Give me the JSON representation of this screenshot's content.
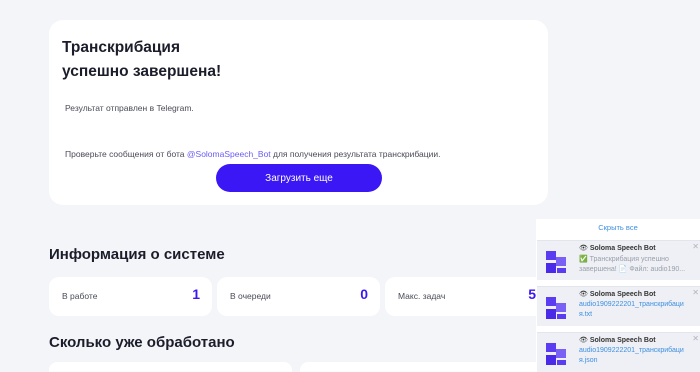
{
  "result_card": {
    "title_line1": "Транскрибация",
    "title_line2": "успешно завершена!",
    "sent_text": "Результат отправлен в Telegram.",
    "check_prefix": "Проверьте сообщения от бота ",
    "bot_link": "@SolomaSpeech_Bot",
    "check_suffix": " для получения результата транскрибации.",
    "upload_button": "Загрузить еще"
  },
  "system_info": {
    "heading": "Информация о системе",
    "stats": [
      {
        "label": "В работе",
        "value": "1"
      },
      {
        "label": "В очереди",
        "value": "0"
      },
      {
        "label": "Макс. задач",
        "value": "5"
      }
    ]
  },
  "processed": {
    "heading": "Сколько уже обработано"
  },
  "notifications": {
    "hide_all": "Скрыть все",
    "items": [
      {
        "sender": "Soloma Speech Bot",
        "eye": "👁",
        "line1": "✅ Транскрибация успешно",
        "line2": "завершена! 📄 Файл: audio190...",
        "close": "✕"
      },
      {
        "sender": "Soloma Speech Bot",
        "eye": "👁",
        "line1": "audio1909222201_транскрибаци",
        "line2": "я.txt",
        "close": "✕"
      },
      {
        "sender": "Soloma Speech Bot",
        "eye": "👁",
        "line1": "audio1909222201_транскрибаци",
        "line2": "я.json",
        "close": "✕"
      }
    ]
  },
  "colors": {
    "accent": "#3b17f5",
    "link": "#6b5cf6",
    "background": "#f4f5f9",
    "notification_link": "#3d8fe0"
  },
  "icons": {
    "bot_logo": "soloma-logo-icon",
    "eye": "eye-icon",
    "close": "close-icon"
  }
}
